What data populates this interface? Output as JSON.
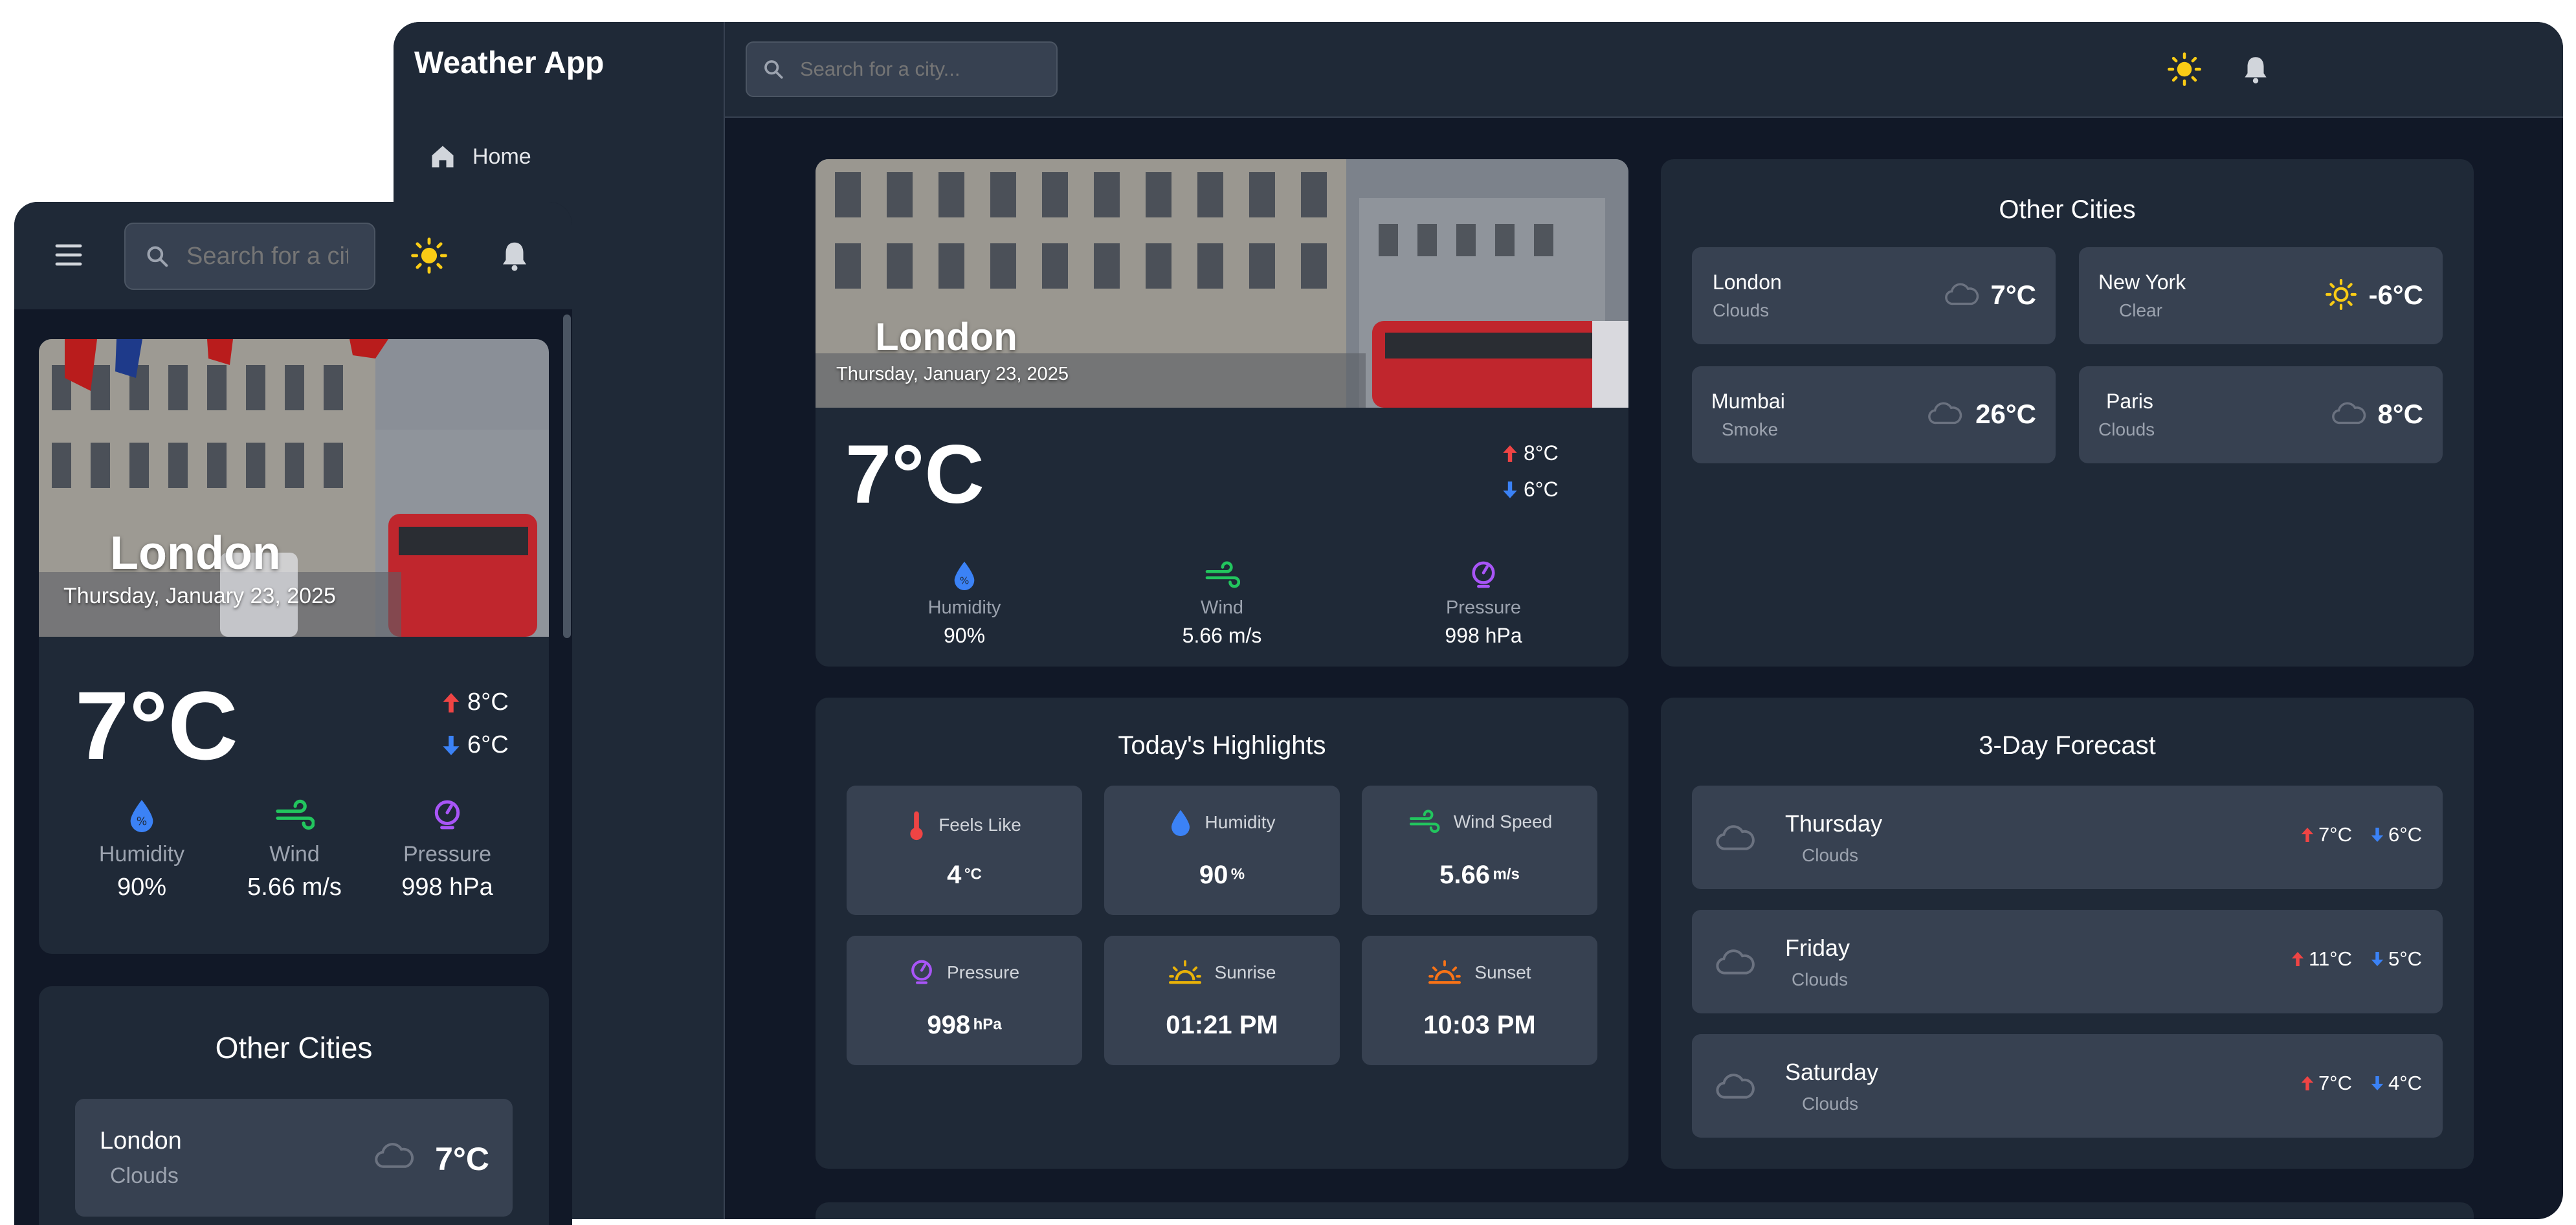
{
  "app": {
    "title": "Weather App"
  },
  "desktop": {
    "sidebar": {
      "items": [
        {
          "label": "Home",
          "icon": "home-icon"
        }
      ]
    },
    "topbar": {
      "search_placeholder": "Search for a city...",
      "icons": [
        "sun-icon",
        "bell-icon"
      ]
    },
    "current": {
      "city": "London",
      "date": "Thursday, January 23, 2025",
      "temp": "7°C",
      "high": "8°C",
      "low": "6°C",
      "stats": [
        {
          "label": "Humidity",
          "value": "90%",
          "icon": "humidity-icon"
        },
        {
          "label": "Wind",
          "value": "5.66 m/s",
          "icon": "wind-icon"
        },
        {
          "label": "Pressure",
          "value": "998 hPa",
          "icon": "pressure-icon"
        }
      ]
    },
    "other_cities": {
      "title": "Other Cities",
      "items": [
        {
          "name": "London",
          "condition": "Clouds",
          "temp": "7°C",
          "icon": "cloud-icon"
        },
        {
          "name": "New York",
          "condition": "Clear",
          "temp": "-6°C",
          "icon": "sun-icon"
        },
        {
          "name": "Mumbai",
          "condition": "Smoke",
          "temp": "26°C",
          "icon": "cloud-icon"
        },
        {
          "name": "Paris",
          "condition": "Clouds",
          "temp": "8°C",
          "icon": "cloud-icon"
        }
      ]
    },
    "highlights": {
      "title": "Today's Highlights",
      "items": [
        {
          "label": "Feels Like",
          "value": "4",
          "unit": "°C",
          "icon": "thermometer-icon"
        },
        {
          "label": "Humidity",
          "value": "90",
          "unit": "%",
          "icon": "humidity-icon"
        },
        {
          "label": "Wind Speed",
          "value": "5.66",
          "unit": "m/s",
          "icon": "wind-icon"
        },
        {
          "label": "Pressure",
          "value": "998",
          "unit": "hPa",
          "icon": "pressure-icon"
        },
        {
          "label": "Sunrise",
          "value": "01:21 PM",
          "unit": "",
          "icon": "sunrise-icon"
        },
        {
          "label": "Sunset",
          "value": "10:03 PM",
          "unit": "",
          "icon": "sunset-icon"
        }
      ]
    },
    "forecast": {
      "title": "3-Day Forecast",
      "days": [
        {
          "day": "Thursday",
          "condition": "Clouds",
          "high": "7°C",
          "low": "6°C",
          "icon": "cloud-icon"
        },
        {
          "day": "Friday",
          "condition": "Clouds",
          "high": "11°C",
          "low": "5°C",
          "icon": "cloud-icon"
        },
        {
          "day": "Saturday",
          "condition": "Clouds",
          "high": "7°C",
          "low": "4°C",
          "icon": "cloud-icon"
        }
      ]
    }
  },
  "mobile": {
    "search_placeholder": "Search for a city...",
    "current": {
      "city": "London",
      "date": "Thursday, January 23, 2025",
      "temp": "7°C",
      "high": "8°C",
      "low": "6°C",
      "stats": [
        {
          "label": "Humidity",
          "value": "90%"
        },
        {
          "label": "Wind",
          "value": "5.66 m/s"
        },
        {
          "label": "Pressure",
          "value": "998 hPa"
        }
      ]
    },
    "other_cities": {
      "title": "Other Cities",
      "items": [
        {
          "name": "London",
          "condition": "Clouds",
          "temp": "7°C"
        }
      ]
    }
  },
  "colors": {
    "app_bg": "#111827",
    "panel": "#1f2937",
    "tile": "#374151",
    "accent_red": "#ef4444",
    "accent_blue": "#3b82f6",
    "accent_green": "#22c55e",
    "accent_purple": "#a855f7",
    "accent_yellow": "#facc15",
    "accent_orange": "#f97316"
  }
}
